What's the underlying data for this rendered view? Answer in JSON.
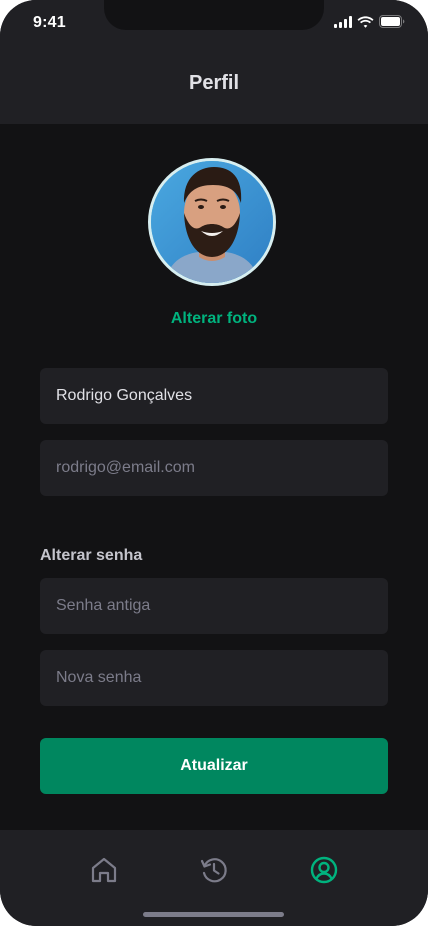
{
  "status_bar": {
    "time": "9:41"
  },
  "header": {
    "title": "Perfil"
  },
  "profile": {
    "change_photo_label": "Alterar foto"
  },
  "form": {
    "name_value": "Rodrigo Gonçalves",
    "email_placeholder": "rodrigo@email.com",
    "password_section_title": "Alterar senha",
    "old_password_placeholder": "Senha antiga",
    "new_password_placeholder": "Nova senha",
    "submit_label": "Atualizar"
  },
  "tabs": [
    {
      "icon": "home-icon",
      "active": false
    },
    {
      "icon": "history-icon",
      "active": false
    },
    {
      "icon": "user-circle-icon",
      "active": true
    }
  ],
  "colors": {
    "background": "#121214",
    "surface": "#202024",
    "accent": "#00B37E",
    "button": "#00875F",
    "inactive_icon": "#7C7C8A"
  }
}
